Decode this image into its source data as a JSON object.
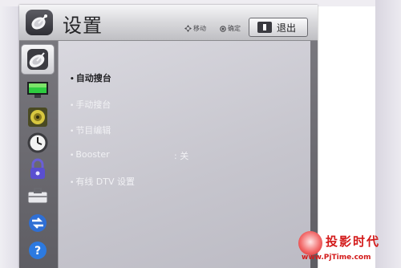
{
  "header": {
    "title": "设置",
    "hint_move": "移动",
    "hint_ok": "确定",
    "exit_key": "EXIT",
    "exit_label": "退出"
  },
  "sidebar": {
    "items": [
      {
        "icon": "satellite-icon",
        "active": true
      },
      {
        "icon": "monitor-icon",
        "active": false
      },
      {
        "icon": "speaker-icon",
        "active": false
      },
      {
        "icon": "clock-icon",
        "active": false
      },
      {
        "icon": "lock-icon",
        "active": false
      },
      {
        "icon": "toolbox-icon",
        "active": false
      },
      {
        "icon": "network-icon",
        "active": false
      },
      {
        "icon": "help-icon",
        "active": false
      }
    ]
  },
  "menu": {
    "items": [
      {
        "label": "自动搜台",
        "selected": true
      },
      {
        "label": "手动搜台",
        "selected": false
      },
      {
        "label": "节目编辑",
        "selected": false
      },
      {
        "label": "Booster",
        "value": ": 关",
        "selected": false
      },
      {
        "label": "有线 DTV 设置",
        "selected": false
      }
    ]
  },
  "watermark": {
    "name": "投影时代",
    "url": "www.PjTime.com"
  }
}
